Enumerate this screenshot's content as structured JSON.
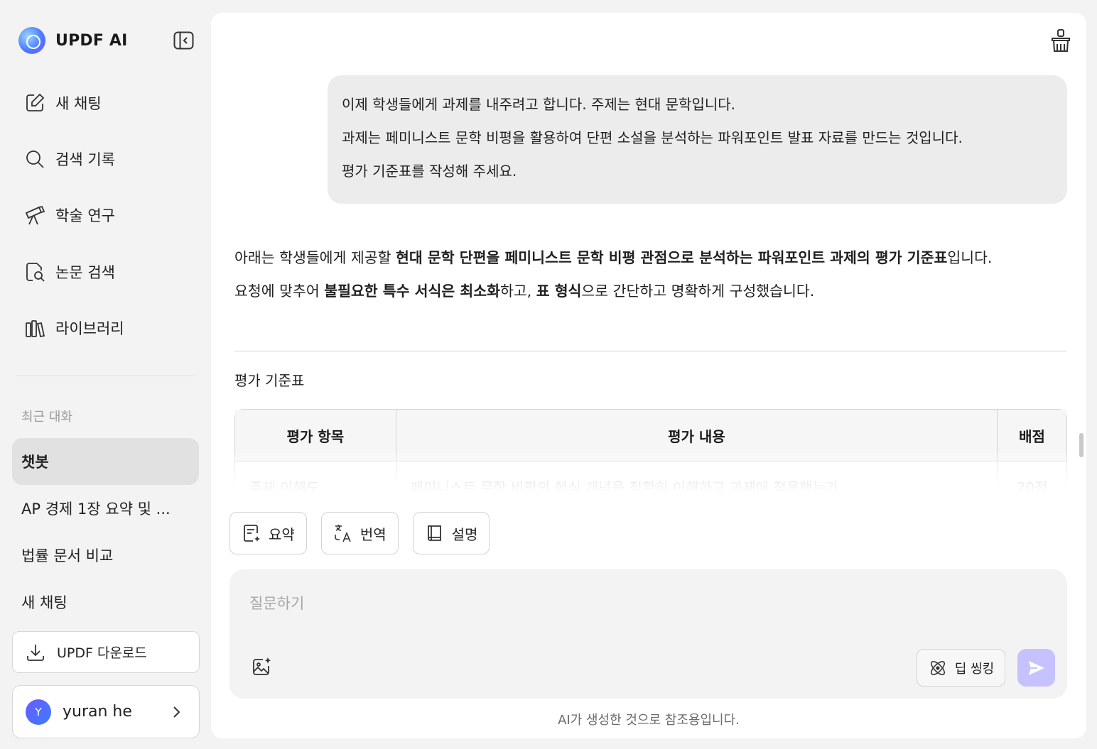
{
  "app": {
    "title": "UPDF AI"
  },
  "sidebar": {
    "nav": [
      {
        "label": "새 채팅",
        "icon": "edit-icon"
      },
      {
        "label": "검색 기록",
        "icon": "search-icon"
      },
      {
        "label": "학술 연구",
        "icon": "telescope-icon"
      },
      {
        "label": "논문 검색",
        "icon": "paper-search-icon"
      },
      {
        "label": "라이브러리",
        "icon": "library-icon"
      }
    ],
    "recent_title": "최근 대화",
    "recent": [
      {
        "label": "챗봇",
        "active": true
      },
      {
        "label": "AP 경제 1장 요약 및 ..."
      },
      {
        "label": "법률 문서 비교"
      },
      {
        "label": "새 채팅"
      }
    ],
    "download_label": "UPDF 다운로드",
    "user": {
      "initial": "Y",
      "name": "yuran he"
    }
  },
  "chat": {
    "user_message": [
      "이제 학생들에게 과제를 내주려고 합니다. 주제는 현대 문학입니다.",
      "과제는 페미니스트 문학 비평을 활용하여 단편 소설을 분석하는 파워포인트 발표 자료를 만드는 것입니다.",
      "평가 기준표를 작성해 주세요."
    ],
    "answer": {
      "p1_a": "아래는 학생들에게 제공할 ",
      "p1_b": "현대 문학 단편을 페미니스트 문학 비평 관점으로 분석하는 파워포인트 과제의 평가 기준표",
      "p1_c": "입니다.",
      "p2_a": "요청에 맞추어 ",
      "p2_b": "불필요한 특수 서식은 최소화",
      "p2_c": "하고, ",
      "p2_d": "표 형식",
      "p2_e": "으로 간단하고 명확하게 구성했습니다."
    },
    "section_title": "평가 기준표",
    "table": {
      "headers": [
        "평가 항목",
        "평가 내용",
        "배점"
      ],
      "rows": [
        [
          "주제 이해도",
          "페미니스트 문학 비평의 핵심 개념을 정확히 이해하고 과제에 적용했는가",
          "20점"
        ]
      ]
    }
  },
  "quick_actions": [
    {
      "label": "요약",
      "icon": "summary-icon"
    },
    {
      "label": "번역",
      "icon": "translate-icon"
    },
    {
      "label": "설명",
      "icon": "book-icon"
    }
  ],
  "input": {
    "placeholder": "질문하기",
    "deep_thinking_label": "딥 씽킹"
  },
  "disclaimer": "AI가 생성한 것으로 참조용입니다."
}
